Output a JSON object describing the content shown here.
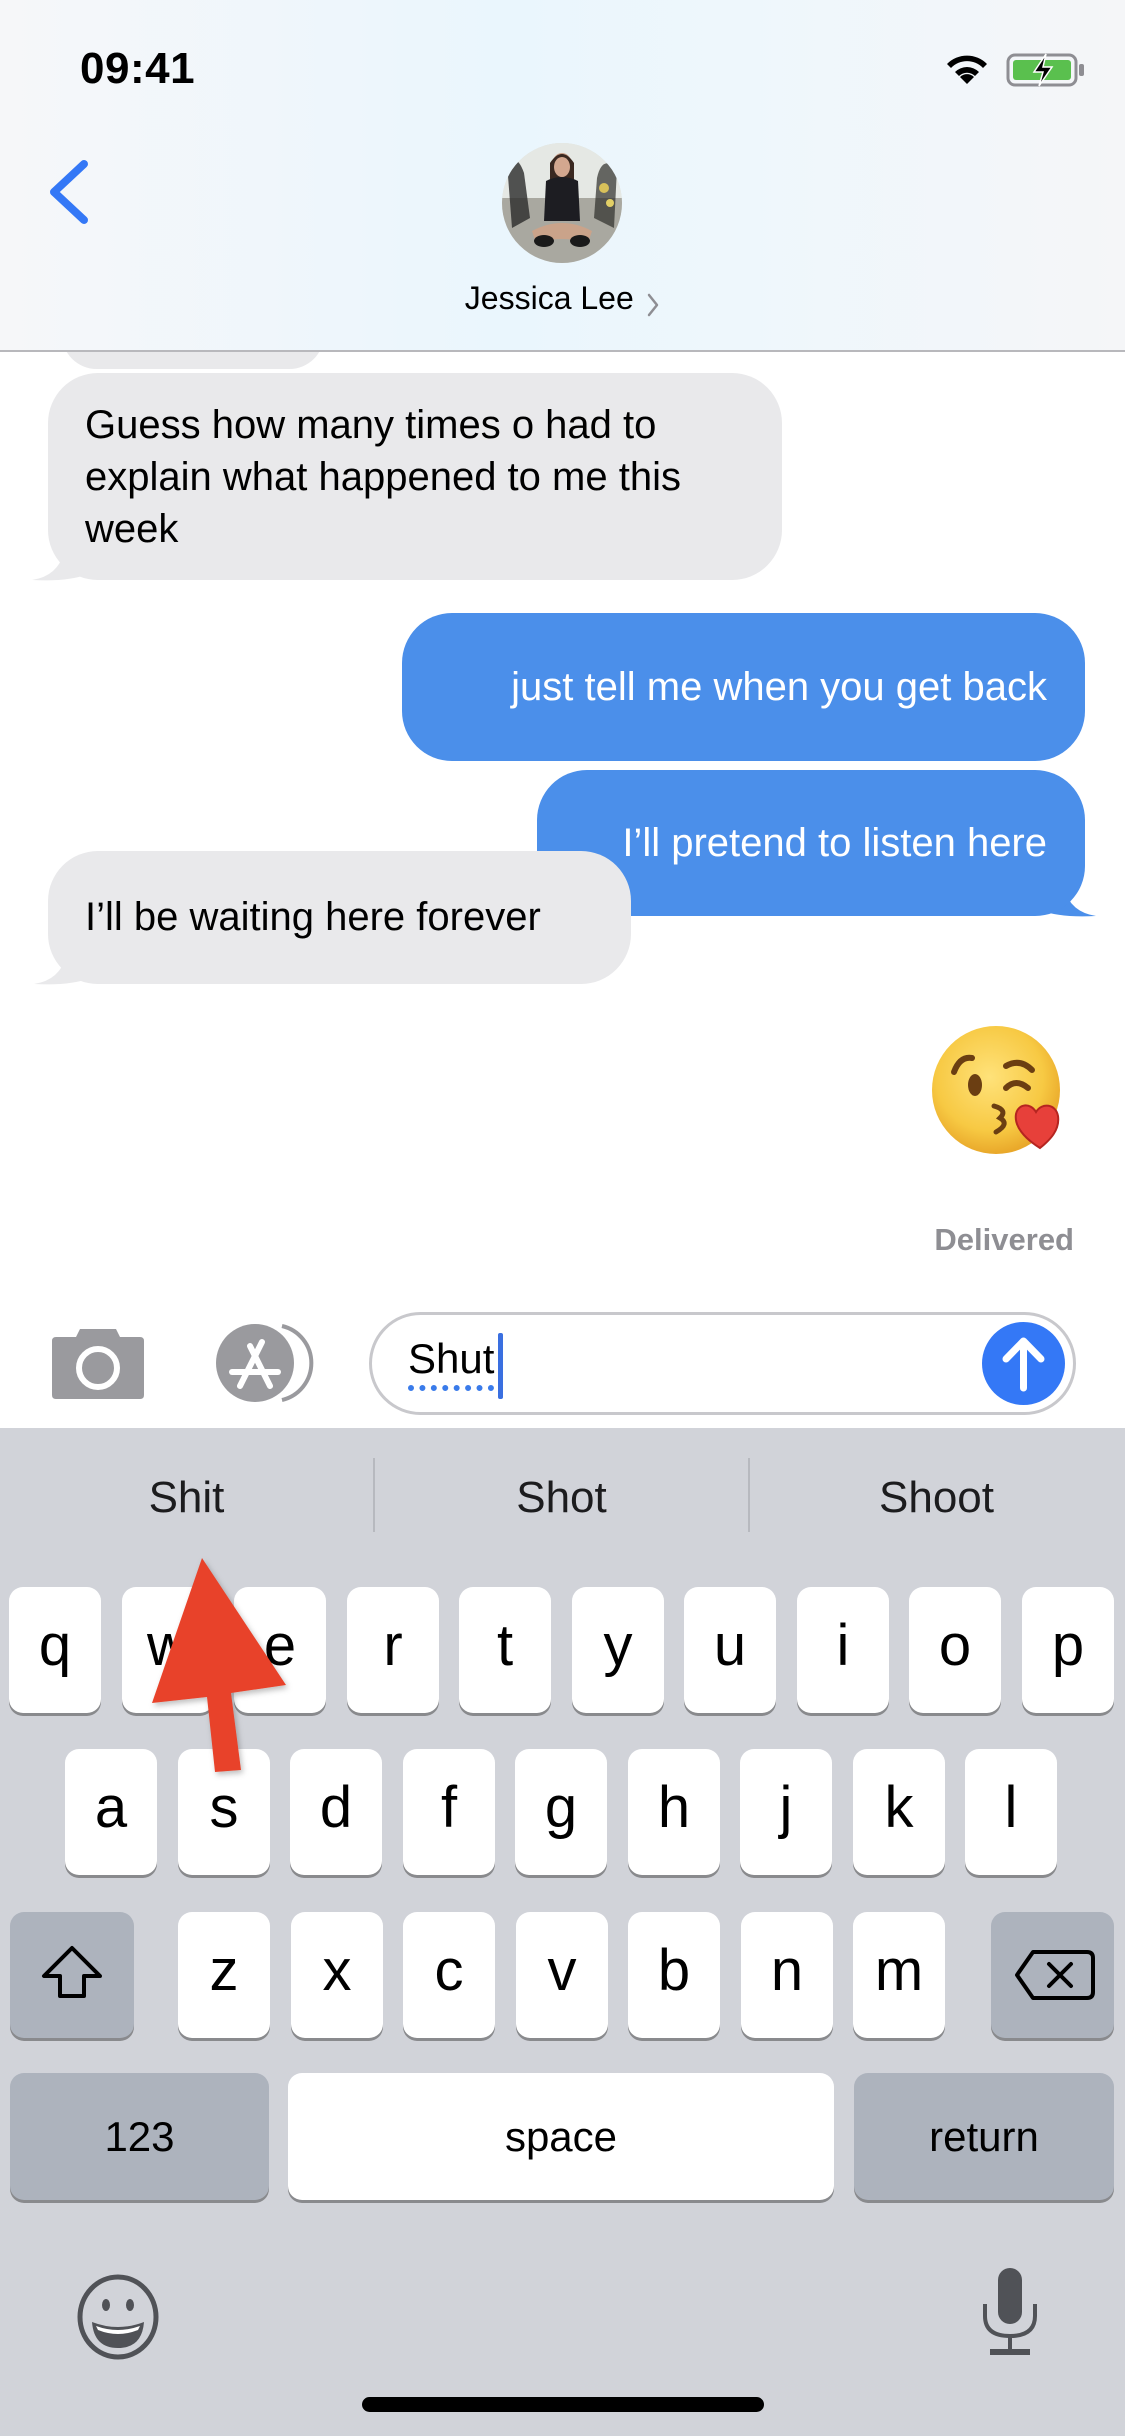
{
  "status_bar": {
    "time": "09:41",
    "wifi_icon": "wifi-icon",
    "battery_icon": "battery-charging-icon",
    "battery_color": "#5ac04e"
  },
  "header": {
    "back_icon": "chevron-left-icon",
    "contact_name": "Jessica Lee",
    "contact_chevron_icon": "chevron-right-icon",
    "avatar_icon": "contact-photo"
  },
  "messages": [
    {
      "direction": "incoming",
      "text": "Guess how many times o had to explain what happened to me this week",
      "lines": [
        "Guess how many times o had to",
        "explain what happened to me this",
        "week"
      ]
    },
    {
      "direction": "outgoing",
      "text": "just tell me when you get back"
    },
    {
      "direction": "outgoing",
      "text": "I’ll pretend to listen here"
    },
    {
      "direction": "incoming",
      "text": "I’ll be waiting here forever"
    },
    {
      "direction": "outgoing",
      "text": "😘",
      "type": "emoji",
      "icon": "face-blowing-kiss-emoji"
    }
  ],
  "delivery_status": "Delivered",
  "compose": {
    "camera_icon": "camera-icon",
    "appstore_icon": "app-store-icon",
    "input_value": "Shut",
    "send_icon": "arrow-up-icon"
  },
  "keyboard": {
    "suggestions": [
      "Shit",
      "Shot",
      "Shoot"
    ],
    "row1": [
      "q",
      "w",
      "e",
      "r",
      "t",
      "y",
      "u",
      "i",
      "o",
      "p"
    ],
    "row2": [
      "a",
      "s",
      "d",
      "f",
      "g",
      "h",
      "j",
      "k",
      "l"
    ],
    "row3": [
      "z",
      "x",
      "c",
      "v",
      "b",
      "n",
      "m"
    ],
    "shift_icon": "shift-icon",
    "delete_icon": "delete-backspace-icon",
    "numbers_label": "123",
    "space_label": "space",
    "return_label": "return",
    "emoji_icon": "emoji-keyboard-icon",
    "mic_icon": "microphone-icon"
  },
  "annotation": {
    "type": "red-arrow",
    "points_to": "suggestion-shit",
    "color": "#e8432b"
  },
  "colors": {
    "outgoing_bubble": "#4b8fea",
    "incoming_bubble": "#e9e9eb",
    "send_button": "#3478f6",
    "back_chevron": "#3478f6",
    "keyboard_bg": "#d1d3d9",
    "special_key": "#adb3bd"
  }
}
